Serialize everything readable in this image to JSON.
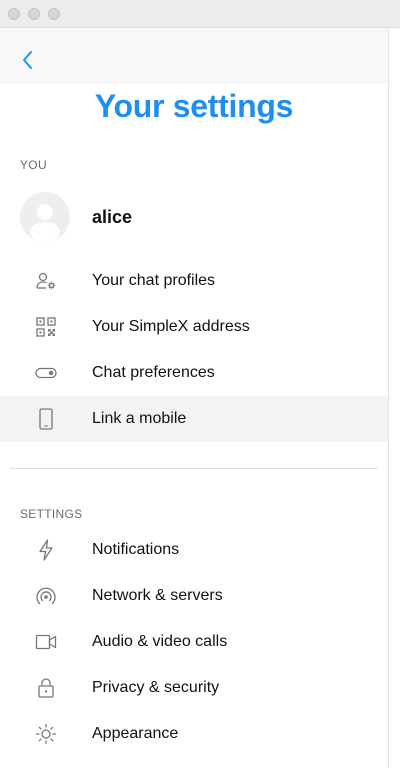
{
  "window": {
    "title": "Your settings",
    "traffic_lights": [
      "close",
      "minimize",
      "zoom"
    ]
  },
  "header": {
    "back_icon": "chevron-left-icon",
    "title": "Your settings",
    "accent_color": "#1f8ef1"
  },
  "you_section": {
    "label": "YOU",
    "profile": {
      "name": "alice",
      "avatar_icon": "default-avatar-icon"
    },
    "items": [
      {
        "label": "Your chat profiles",
        "icon": "user-settings-icon"
      },
      {
        "label": "Your SimpleX address",
        "icon": "qr-code-icon"
      },
      {
        "label": "Chat preferences",
        "icon": "toggle-icon"
      },
      {
        "label": "Link a mobile",
        "icon": "mobile-phone-icon",
        "highlighted": true
      }
    ]
  },
  "settings_section": {
    "label": "SETTINGS",
    "items": [
      {
        "label": "Notifications",
        "icon": "bolt-icon"
      },
      {
        "label": "Network & servers",
        "icon": "wireless-icon"
      },
      {
        "label": "Audio & video calls",
        "icon": "video-camera-icon"
      },
      {
        "label": "Privacy & security",
        "icon": "lock-icon"
      },
      {
        "label": "Appearance",
        "icon": "sun-icon"
      }
    ]
  }
}
